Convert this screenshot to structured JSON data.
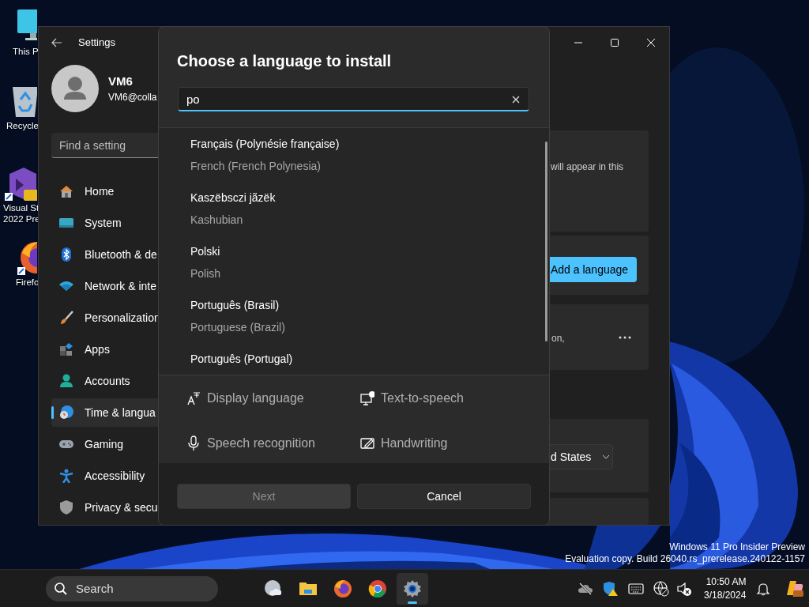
{
  "desktop_icons": [
    {
      "lines": [
        "This P"
      ]
    },
    {
      "lines": [
        "Recycle"
      ]
    },
    {
      "lines": [
        "Visual St",
        "2022 Pre"
      ]
    },
    {
      "lines": [
        "Firefo"
      ]
    }
  ],
  "settings_window": {
    "title": "Settings",
    "user": {
      "name": "VM6",
      "email": "VM6@colla"
    },
    "search": {
      "placeholder": "Find a setting"
    },
    "nav": [
      {
        "label": "Home",
        "selected": false
      },
      {
        "label": "System",
        "selected": false
      },
      {
        "label": "Bluetooth & de",
        "selected": false
      },
      {
        "label": "Network & inte",
        "selected": false
      },
      {
        "label": "Personalization",
        "selected": false
      },
      {
        "label": "Apps",
        "selected": false
      },
      {
        "label": "Accounts",
        "selected": false
      },
      {
        "label": "Time & langua",
        "selected": true
      },
      {
        "label": "Gaming",
        "selected": false
      },
      {
        "label": "Accessibility",
        "selected": false
      },
      {
        "label": "Privacy & secu",
        "selected": false
      }
    ],
    "content": {
      "card_text": "will appear in this",
      "add_button": "Add a language",
      "option_text": "on,",
      "region_dropdown": "d States"
    }
  },
  "dialog": {
    "title": "Choose a language to install",
    "search": {
      "value": "po"
    },
    "results": [
      {
        "native": "Français (Polynésie française)",
        "english": "French (French Polynesia)"
      },
      {
        "native": "Kaszëbsczi jãzëk",
        "english": "Kashubian"
      },
      {
        "native": "Polski",
        "english": "Polish"
      },
      {
        "native": "Português (Brasil)",
        "english": "Portuguese (Brazil)"
      },
      {
        "native": "Português (Portugal)"
      }
    ],
    "features": [
      {
        "label": "Display language"
      },
      {
        "label": "Text-to-speech"
      },
      {
        "label": "Speech recognition"
      },
      {
        "label": "Handwriting"
      }
    ],
    "buttons": [
      {
        "label": "Next",
        "disabled": true
      },
      {
        "label": "Cancel",
        "disabled": false
      }
    ]
  },
  "build_info": [
    "Windows 11 Pro Insider Preview",
    "Evaluation copy. Build 26040.rs_prerelease.240122-1157"
  ],
  "taskbar": {
    "search": "Search",
    "apps": [
      {
        "active": false
      },
      {
        "active": false
      },
      {
        "active": false
      },
      {
        "active": false
      },
      {
        "active": true
      }
    ],
    "clock": {
      "time": "10:50 AM",
      "date": "3/18/2024"
    }
  }
}
